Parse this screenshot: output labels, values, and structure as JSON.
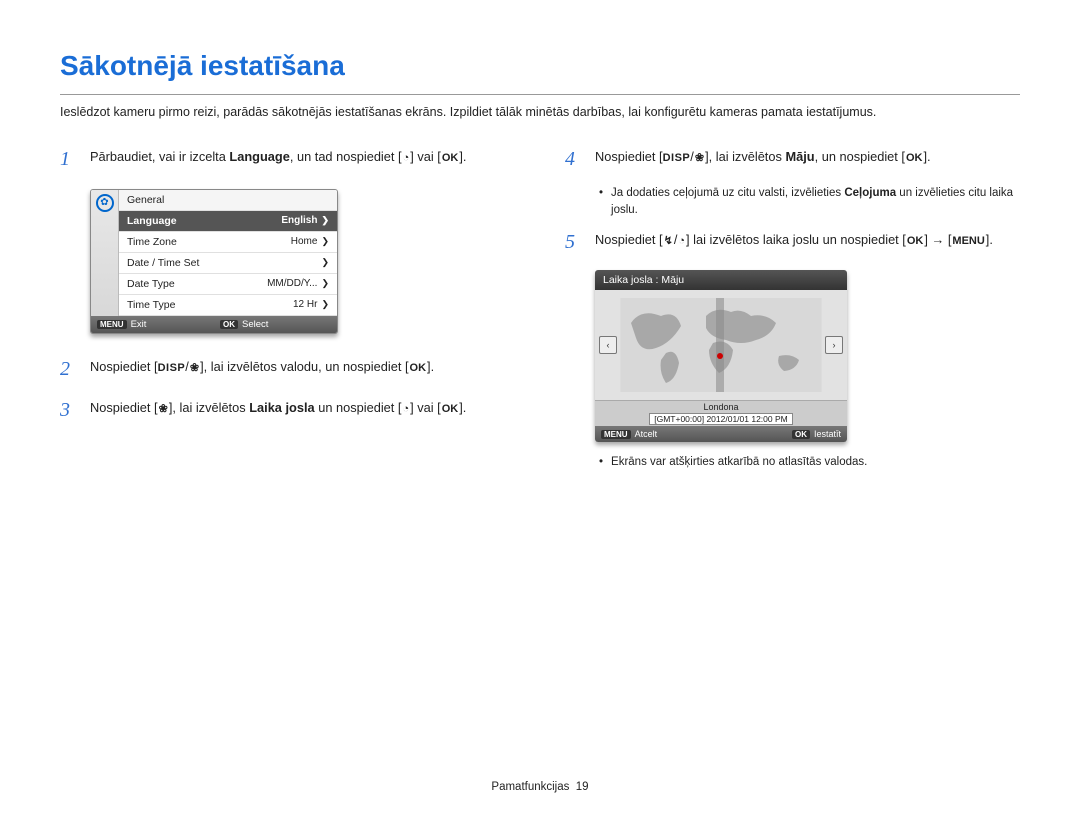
{
  "title": "Sākotnējā iestatīšana",
  "intro": "Ieslēdzot kameru pirmo reizi, parādās sākotnējās iestatīšanas ekrāns. Izpildiet tālāk minētās darbības, lai konfigurētu kameras pamata iestatījumus.",
  "steps": {
    "s1": {
      "num": "1",
      "t1": "Pārbaudiet, vai ir izcelta ",
      "bold1": "Language",
      "t2": ", un tad nospiediet ",
      "t3": " vai "
    },
    "s2": {
      "num": "2",
      "t1": "Nospiediet ",
      "t2": ", lai izvēlētos valodu, un nospiediet "
    },
    "s3": {
      "num": "3",
      "t1": "Nospiediet ",
      "t2": ", lai izvēlētos ",
      "bold1": "Laika josla",
      "t3": " un nospiediet ",
      "t4": " vai "
    },
    "s4": {
      "num": "4",
      "t1": "Nospiediet ",
      "t2": ", lai izvēlētos ",
      "bold1": "Māju",
      "t3": ", un nospiediet "
    },
    "s4_bullet": {
      "p1": "Ja dodaties ceļojumā uz citu valsti, izvēlieties ",
      "bold": "Ceļojuma",
      "p2": " un izvēlieties citu laika joslu."
    },
    "s5": {
      "num": "5",
      "t1": "Nospiediet ",
      "t2": " lai izvēlētos laika joslu un nospiediet ",
      "t3": " → "
    },
    "s5_bullet": "Ekrāns var atšķirties atkarībā no atlasītās valodas."
  },
  "glyphs": {
    "disp": "DISP",
    "flower": "❀",
    "timer": "◔",
    "flash": "↯",
    "ok": "OK",
    "menu": "MENU"
  },
  "settings": {
    "header": "General",
    "rows": [
      {
        "label": "Language",
        "value": "English",
        "highlight": true
      },
      {
        "label": "Time Zone",
        "value": "Home"
      },
      {
        "label": "Date / Time Set",
        "value": ""
      },
      {
        "label": "Date Type",
        "value": "MM/DD/Y..."
      },
      {
        "label": "Time Type",
        "value": "12 Hr"
      }
    ],
    "footer": {
      "exit_btn": "MENU",
      "exit": "Exit",
      "select_btn": "OK",
      "select": "Select"
    }
  },
  "map": {
    "header": "Laika josla : Māju",
    "city": "Londona",
    "tz": "[GMT+00:00] 2012/01/01 12:00 PM",
    "footer": {
      "cancel_btn": "MENU",
      "cancel": "Atcelt",
      "set_btn": "OK",
      "set": "Iestatīt"
    }
  },
  "footer": {
    "section": "Pamatfunkcijas",
    "page": "19"
  }
}
